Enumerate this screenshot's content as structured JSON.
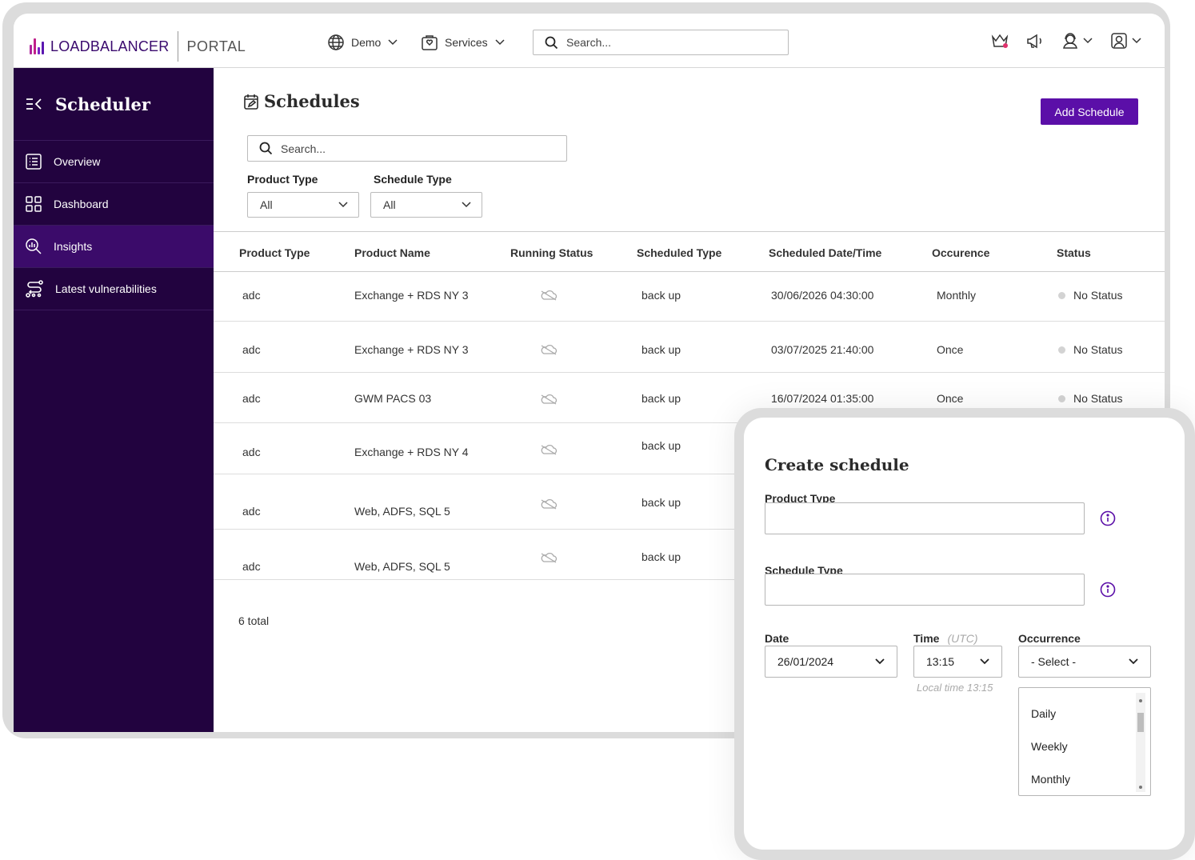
{
  "topbar": {
    "logo_text": "LOADBALANCER",
    "portal_text": "PORTAL",
    "env_label": "Demo",
    "services_label": "Services",
    "search_placeholder": "Search..."
  },
  "sidebar": {
    "title": "Scheduler",
    "items": [
      {
        "label": "Overview",
        "icon": "list-icon"
      },
      {
        "label": "Dashboard",
        "icon": "grid-icon"
      },
      {
        "label": "Insights",
        "icon": "insights-icon",
        "active": true
      },
      {
        "label": "Latest vulnerabilities",
        "icon": "route-icon"
      }
    ]
  },
  "main": {
    "title": "Schedules",
    "add_button": "Add Schedule",
    "search_placeholder": "Search...",
    "filters": {
      "product_type_label": "Product Type",
      "product_type_value": "All",
      "schedule_type_label": "Schedule Type",
      "schedule_type_value": "All"
    },
    "table": {
      "columns": [
        "Product Type",
        "Product Name",
        "Running Status",
        "Scheduled Type",
        "Scheduled Date/Time",
        "Occurence",
        "Status"
      ],
      "rows": [
        {
          "product_type": "adc",
          "product_name": "Exchange + RDS NY 3",
          "scheduled_type": "back up",
          "datetime": "30/06/2026 04:30:00",
          "occurence": "Monthly",
          "status": "No Status"
        },
        {
          "product_type": "adc",
          "product_name": "Exchange + RDS NY 3",
          "scheduled_type": "back up",
          "datetime": "03/07/2025 21:40:00",
          "occurence": "Once",
          "status": "No Status"
        },
        {
          "product_type": "adc",
          "product_name": "GWM PACS 03",
          "scheduled_type": "back up",
          "datetime": "16/07/2024 01:35:00",
          "occurence": "Once",
          "status": "No Status"
        },
        {
          "product_type": "adc",
          "product_name": "Exchange + RDS NY 4",
          "scheduled_type": "back up"
        },
        {
          "product_type": "adc",
          "product_name": "Web, ADFS, SQL 5",
          "scheduled_type": "back up"
        },
        {
          "product_type": "adc",
          "product_name": "Web, ADFS, SQL 5",
          "scheduled_type": "back up"
        }
      ]
    },
    "total": "6 total"
  },
  "modal": {
    "title": "Create schedule",
    "product_type_label": "Product Type",
    "schedule_type_label": "Schedule Type",
    "date_label": "Date",
    "date_value": "26/01/2024",
    "time_label": "Time",
    "time_unit": "(UTC)",
    "time_value": "13:15",
    "local_time_hint": "Local time 13:15",
    "occurrence_label": "Occurrence",
    "occurrence_value": "- Select -",
    "occurrence_options": [
      "Daily",
      "Weekly",
      "Monthly"
    ]
  },
  "colors": {
    "sidebar_bg": "#22033f",
    "sidebar_active": "#3b0b6a",
    "accent": "#5b0fa8",
    "logo_text": "#3a0a6e"
  }
}
